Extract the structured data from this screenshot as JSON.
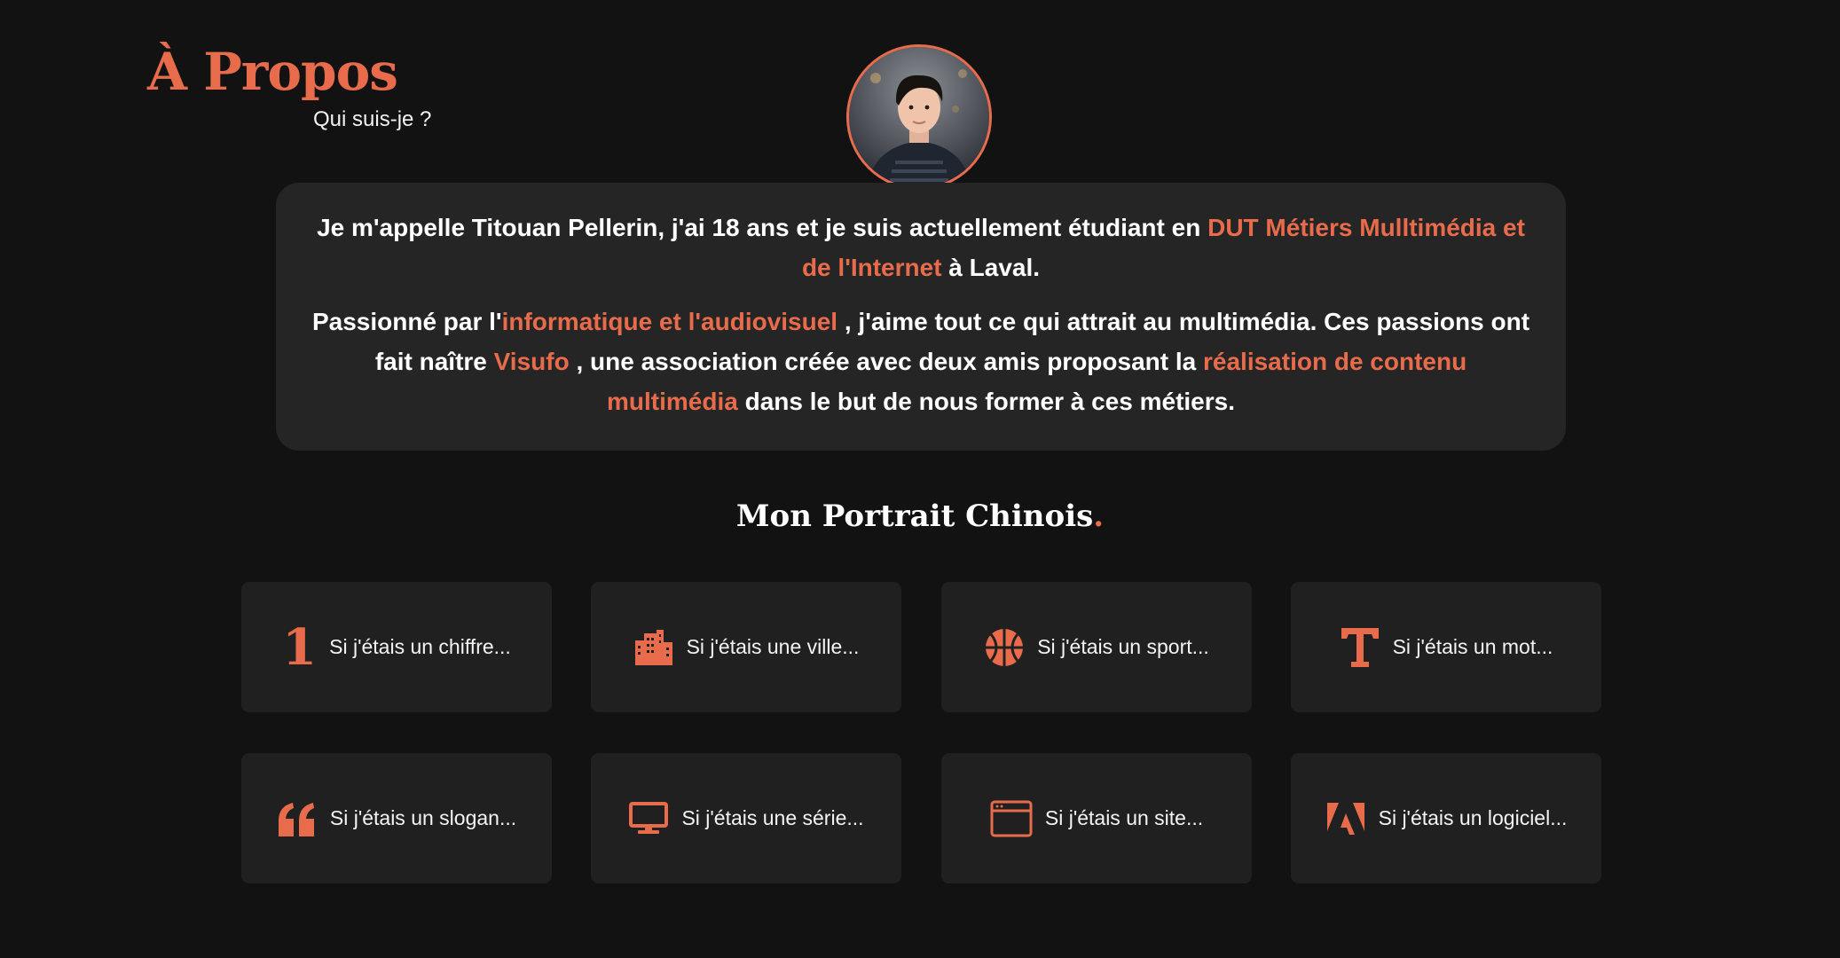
{
  "header": {
    "title": "À Propos",
    "subtitle": "Qui suis-je ?"
  },
  "bio": {
    "p1_a": "Je m'appelle Titouan Pellerin, j'ai 18 ans et je suis actuellement étudiant en ",
    "p1_link": "DUT Métiers Mulltimédia et de l'Internet",
    "p1_b": " à Laval.",
    "p2_a": "Passionné par l'",
    "p2_link1": "informatique et l'audiovisuel",
    "p2_b": " , j'aime tout ce qui attrait au multimédia. Ces passions ont fait naître ",
    "p2_link2": "Visufo",
    "p2_c": " , une association créée avec deux amis proposant la ",
    "p2_link3": "réalisation de contenu multimédia",
    "p2_d": " dans le but de nous former à ces métiers."
  },
  "portrait": {
    "title": "Mon Portrait Chinois",
    "title_dot": ".",
    "cards": [
      {
        "label": "Si j'étais un chiffre...",
        "icon": "number-one-icon",
        "glyph": "1"
      },
      {
        "label": "Si j'étais une ville...",
        "icon": "city-icon"
      },
      {
        "label": "Si j'étais un sport...",
        "icon": "basketball-icon"
      },
      {
        "label": "Si j'étais un mot...",
        "icon": "text-icon"
      },
      {
        "label": "Si j'étais un slogan...",
        "icon": "quote-icon"
      },
      {
        "label": "Si j'étais une série...",
        "icon": "desktop-icon"
      },
      {
        "label": "Si j'étais un site...",
        "icon": "browser-window-icon"
      },
      {
        "label": "Si j'étais un logiciel...",
        "icon": "adobe-icon"
      }
    ]
  },
  "colors": {
    "accent": "#e86c4b",
    "background": "#121212",
    "card": "#202020",
    "bio_card": "#252525"
  }
}
